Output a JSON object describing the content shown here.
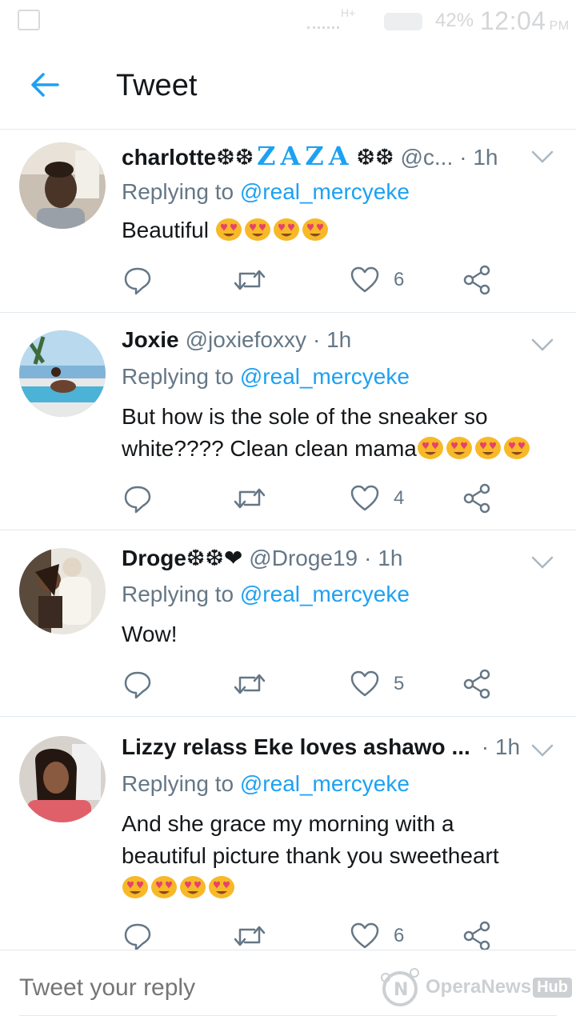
{
  "status_bar": {
    "network": "H+",
    "battery": "42%",
    "time": "12:04",
    "ampm": "PM"
  },
  "header": {
    "title": "Tweet"
  },
  "tweets": [
    {
      "display_name": "charlotte",
      "name_decor_left": "❆❆",
      "name_highlight": "ZAZA",
      "name_decor_right": "❆❆",
      "handle": "@c...",
      "time": "· 1h",
      "replying_prefix": "Replying to ",
      "replying_to": "@real_mercyeke",
      "text": "Beautiful ",
      "emoji_count": 4,
      "actions": {
        "reply_count": "",
        "retweet_count": "",
        "like_count": "6"
      }
    },
    {
      "display_name": "Joxie",
      "name_decor_left": "",
      "handle": "@joxiefoxxy",
      "time": "· 1h",
      "replying_prefix": "Replying to ",
      "replying_to": "@real_mercyeke",
      "text": "But how is the sole of the sneaker so white???? Clean clean mama",
      "emoji_count": 4,
      "actions": {
        "reply_count": "",
        "retweet_count": "",
        "like_count": "4"
      }
    },
    {
      "display_name": "Droge",
      "name_decor_left": "❆❆❤",
      "handle": "@Droge19",
      "time": "· 1h",
      "replying_prefix": "Replying to ",
      "replying_to": "@real_mercyeke",
      "text": "Wow!",
      "emoji_count": 0,
      "actions": {
        "reply_count": "",
        "retweet_count": "",
        "like_count": "5"
      }
    },
    {
      "display_name": "Lizzy relass Eke loves ashawo ...",
      "handle": "",
      "time": "· 1h",
      "replying_prefix": "Replying to ",
      "replying_to": "@real_mercyeke",
      "text": "And she grace my morning with a beautiful picture thank you sweetheart",
      "emoji_count": 4,
      "actions": {
        "reply_count": "",
        "retweet_count": "",
        "like_count": "6"
      }
    }
  ],
  "reply_bar": {
    "placeholder": "Tweet your reply"
  },
  "watermark": {
    "brand": "OperaNews",
    "hub": "Hub"
  },
  "colors": {
    "accent": "#1da1f2",
    "muted": "#657786",
    "text": "#14171a",
    "divider": "#e1e8ed"
  }
}
